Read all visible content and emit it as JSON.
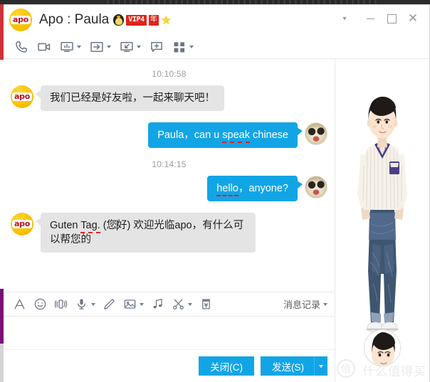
{
  "window": {
    "title": "Apo : Paula",
    "avatar_label": "apo",
    "badges": [
      {
        "name": "qq-penguin-badge",
        "label": ""
      },
      {
        "name": "vip-badge",
        "label": "VIP4"
      },
      {
        "name": "year-badge",
        "label": "年"
      },
      {
        "name": "star-badge",
        "label": "★"
      }
    ],
    "controls": [
      {
        "name": "titlebar-menu-chevron",
        "label": "▾"
      },
      {
        "name": "minimize-button",
        "label": ""
      },
      {
        "name": "maximize-button",
        "label": ""
      },
      {
        "name": "close-button",
        "label": "✕"
      }
    ]
  },
  "toolbar": {
    "items": [
      {
        "name": "voice-call-icon",
        "icon": "phone",
        "caret": false
      },
      {
        "name": "video-call-icon",
        "icon": "video",
        "caret": false
      },
      {
        "name": "screen-share-icon",
        "icon": "monitor",
        "caret": true
      },
      {
        "name": "send-file-icon",
        "icon": "file-arrow",
        "caret": true
      },
      {
        "name": "remote-desktop-icon",
        "icon": "remote",
        "caret": true
      },
      {
        "name": "create-discussion-icon",
        "icon": "chat-plus",
        "caret": false
      },
      {
        "name": "apps-grid-icon",
        "icon": "grid",
        "caret": true
      }
    ]
  },
  "chat": {
    "groups": [
      {
        "timestamp": "10:10:58",
        "messages": [
          {
            "direction": "in",
            "sender": "apo",
            "avatar": "apo-avatar",
            "text": "我们已经是好友啦，一起来聊天吧！",
            "spell_error": ""
          },
          {
            "direction": "out",
            "sender": "Paula",
            "avatar": "dog-avatar",
            "text_before": "Paula，can u ",
            "spell_error": "speak",
            "text_after": " chinese"
          }
        ]
      },
      {
        "timestamp": "10:14:15",
        "messages": [
          {
            "direction": "out",
            "sender": "Paula",
            "avatar": "dog-avatar",
            "text_before": "",
            "spell_error": "hello",
            "text_after": "，anyone?"
          },
          {
            "direction": "in",
            "sender": "apo",
            "avatar": "apo-avatar",
            "text_before": "Guten ",
            "spell_error": "Tag.",
            "text_after": " (您",
            "text_tail": "好)  欢迎光临apo，有什么可以帮您的"
          }
        ]
      }
    ]
  },
  "bottom_toolbar": {
    "items": [
      {
        "name": "font-style-icon",
        "icon": "font-a",
        "caret": false
      },
      {
        "name": "emoji-icon",
        "icon": "smiley",
        "caret": false
      },
      {
        "name": "shake-window-icon",
        "icon": "shake",
        "caret": false
      },
      {
        "name": "voice-message-icon",
        "icon": "mic",
        "caret": true
      },
      {
        "name": "handwriting-icon",
        "icon": "pen",
        "caret": false
      },
      {
        "name": "send-image-icon",
        "icon": "image",
        "caret": true
      },
      {
        "name": "music-icon",
        "icon": "music",
        "caret": false
      },
      {
        "name": "screenshot-icon",
        "icon": "scissors",
        "caret": true
      },
      {
        "name": "red-envelope-icon",
        "icon": "envelope",
        "caret": false
      }
    ],
    "history_label": "消息记录"
  },
  "input": {
    "value": "",
    "placeholder": ""
  },
  "actions": {
    "close_label": "关闭(C)",
    "send_label": "发送(S)"
  },
  "qqshow": {
    "character_alt": "qq-show-character",
    "profile_alt": "profile-picture"
  },
  "watermark": {
    "text": "什么值得买",
    "mark": "值"
  },
  "colors": {
    "accent": "#12a5e6",
    "incoming_bubble": "#e4e4e4",
    "badge_red": "#e1241b",
    "avatar_yellow": "#fcc200",
    "spell_underline": "#e02020"
  }
}
